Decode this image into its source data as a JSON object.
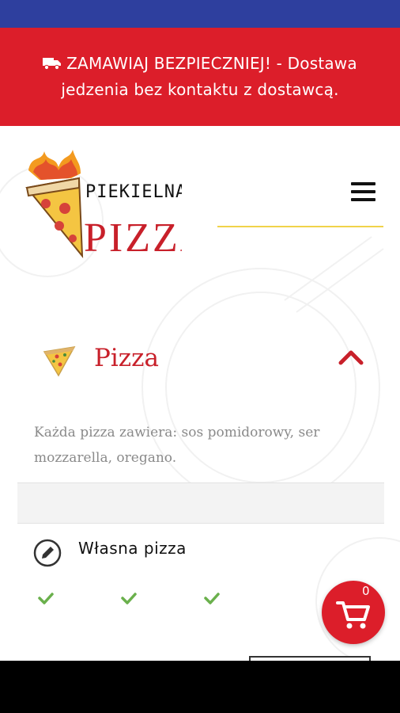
{
  "promo": {
    "text": "ZAMAWIAJ BEZPIECZNIEJ! - Dostawa jedzenia bez kontaktu z dostawcą.",
    "icon": "truck-icon"
  },
  "header": {
    "logo_top": "PIEKIELNA",
    "logo_bottom": "PIZZA",
    "menu_icon": "hamburger-icon"
  },
  "category": {
    "title": "Pizza",
    "icon": "pizza-slice-icon",
    "expanded": true,
    "description": "Każda pizza zawiera: sos pomidorowy, ser mozzarella, oregano."
  },
  "item": {
    "title": "Własna pizza",
    "icon": "edit-icon"
  },
  "cart": {
    "count": "0",
    "icon": "cart-icon"
  },
  "colors": {
    "brand_red": "#dc1e2a",
    "status_blue": "#2e3f9e",
    "accent_yellow": "#f0d34a",
    "check_green": "#6ab04c"
  }
}
